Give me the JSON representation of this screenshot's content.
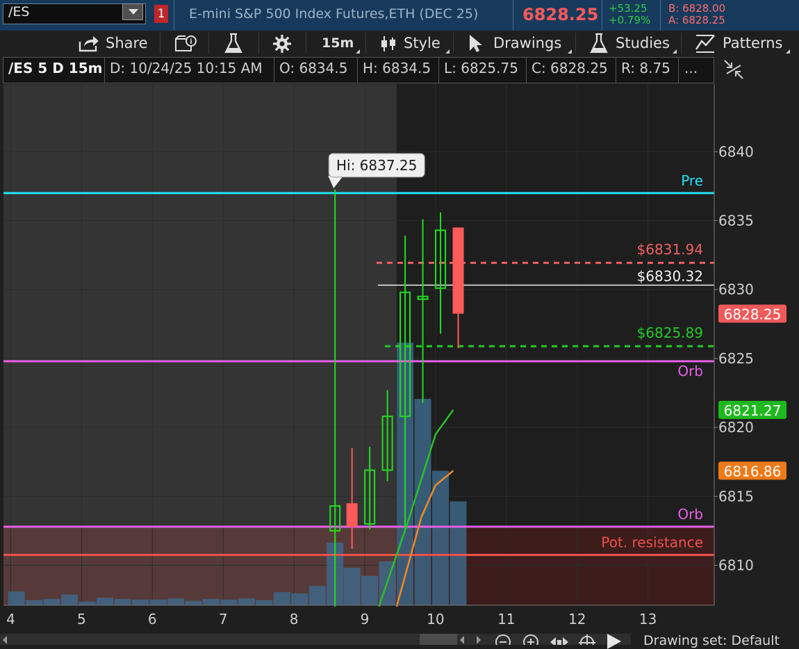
{
  "header": {
    "symbol": "/ES",
    "alert_count": "1",
    "description": "E-mini S&P 500 Index Futures,ETH (DEC 25)",
    "last_price": "6828.25",
    "net_change": "+53.25",
    "pct_change": "+0.79%",
    "bid": "B: 6828.00",
    "ask": "A: 6828.25",
    "colors": {
      "up": "#2ecc40",
      "down": "#ff5a5a",
      "header_bg": "#173a5c"
    }
  },
  "toolbar": {
    "share": "Share",
    "timeframe": "15m",
    "style": "Style",
    "drawings": "Drawings",
    "studies": "Studies",
    "patterns": "Patterns"
  },
  "infobar": {
    "label": "/ES 5 D 15m",
    "date": "D: 10/24/25 10:15 AM",
    "open": "O: 6834.5",
    "high": "H: 6834.5",
    "low": "L: 6825.75",
    "close": "C: 6828.25",
    "range": "R: 8.75",
    "more": "..."
  },
  "footer": {
    "drawing_set": "Drawing set: Default"
  },
  "chart_data": {
    "type": "candlestick",
    "interval": "15m",
    "x_ticks": [
      "4",
      "5",
      "6",
      "7",
      "8",
      "9",
      "10",
      "11",
      "12",
      "13"
    ],
    "y_ticks": [
      "6810",
      "6815",
      "6820",
      "6825",
      "6830",
      "6835",
      "6840"
    ],
    "ylim": [
      6807,
      6847
    ],
    "candles": [
      {
        "x": 8.58,
        "open": 6812.5,
        "high": 6837.25,
        "low": 6807.0,
        "close": 6814.3
      },
      {
        "x": 8.82,
        "open": 6814.5,
        "high": 6818.5,
        "low": 6811.2,
        "close": 6812.8
      },
      {
        "x": 9.07,
        "open": 6813.0,
        "high": 6818.6,
        "low": 6812.6,
        "close": 6816.9
      },
      {
        "x": 9.32,
        "open": 6816.9,
        "high": 6822.7,
        "low": 6816.1,
        "close": 6820.8
      },
      {
        "x": 9.57,
        "open": 6820.8,
        "high": 6833.9,
        "low": 6812.6,
        "close": 6829.8
      },
      {
        "x": 9.82,
        "open": 6829.3,
        "high": 6835.1,
        "low": 6821.8,
        "close": 6829.5
      },
      {
        "x": 10.07,
        "open": 6830.1,
        "high": 6835.6,
        "low": 6826.8,
        "close": 6834.3
      },
      {
        "x": 10.32,
        "open": 6834.5,
        "high": 6834.5,
        "low": 6825.75,
        "close": 6828.25
      }
    ],
    "volume": [
      {
        "x": 4.08,
        "value": 0.22
      },
      {
        "x": 4.33,
        "value": 0.08
      },
      {
        "x": 4.58,
        "value": 0.1
      },
      {
        "x": 4.83,
        "value": 0.17
      },
      {
        "x": 5.08,
        "value": 0.06
      },
      {
        "x": 5.33,
        "value": 0.12
      },
      {
        "x": 5.58,
        "value": 0.1
      },
      {
        "x": 5.83,
        "value": 0.09
      },
      {
        "x": 6.08,
        "value": 0.09
      },
      {
        "x": 6.33,
        "value": 0.11
      },
      {
        "x": 6.58,
        "value": 0.07
      },
      {
        "x": 6.83,
        "value": 0.1
      },
      {
        "x": 7.08,
        "value": 0.09
      },
      {
        "x": 7.33,
        "value": 0.11
      },
      {
        "x": 7.58,
        "value": 0.08
      },
      {
        "x": 7.83,
        "value": 0.21
      },
      {
        "x": 8.08,
        "value": 0.19
      },
      {
        "x": 8.33,
        "value": 0.31
      },
      {
        "x": 8.58,
        "value": 1.0
      },
      {
        "x": 8.82,
        "value": 0.6
      },
      {
        "x": 9.07,
        "value": 0.47
      },
      {
        "x": 9.32,
        "value": 0.7
      },
      {
        "x": 9.57,
        "value": 4.2
      },
      {
        "x": 9.82,
        "value": 3.3
      },
      {
        "x": 10.07,
        "value": 2.15
      },
      {
        "x": 10.32,
        "value": 1.66
      }
    ],
    "moving_averages": [
      {
        "name": "",
        "color": "#27c227",
        "points": [
          [
            9.2,
            6807.0
          ],
          [
            9.6,
            6813.0
          ],
          [
            10.0,
            6819.5
          ],
          [
            10.25,
            6821.27
          ]
        ]
      },
      {
        "name": "",
        "color": "#f08a24",
        "points": [
          [
            9.45,
            6807.0
          ],
          [
            9.8,
            6813.5
          ],
          [
            10.0,
            6815.8
          ],
          [
            10.25,
            6816.86
          ]
        ]
      }
    ],
    "levels": [
      {
        "label": "Pre",
        "value": 6837.0,
        "color": "#22e1f2",
        "style": "solid"
      },
      {
        "label": "Orb",
        "value": 6824.8,
        "color": "#e860e8",
        "style": "solid"
      },
      {
        "label": "Orb",
        "value": 6812.8,
        "color": "#e860e8",
        "style": "solid"
      },
      {
        "label": "Pot. resistance",
        "value": 6810.75,
        "color": "#f0504a",
        "style": "solid"
      },
      {
        "label": "$6831.94",
        "value": 6831.94,
        "color": "#f06060",
        "style": "dashed"
      },
      {
        "label": "$6830.32",
        "value": 6830.32,
        "color": "#f0f0f0",
        "style": "solid"
      },
      {
        "label": "$6825.89",
        "value": 6825.89,
        "color": "#22cc22",
        "style": "dashed"
      }
    ],
    "annotation": {
      "text": "Hi: 6837.25",
      "x": 8.58,
      "value": 6837.25
    },
    "price_badges": [
      {
        "text": "6828.25",
        "value": 6828.25,
        "color": "#f05a5a"
      },
      {
        "text": "6821.27",
        "value": 6821.27,
        "color": "#1fb81f"
      },
      {
        "text": "6816.86",
        "value": 6816.86,
        "color": "#f07a18"
      }
    ],
    "session_shading": {
      "premarket_until_x": 9.45,
      "resistance_zone": [
        6807.0,
        6812.8
      ]
    },
    "grid": true
  }
}
